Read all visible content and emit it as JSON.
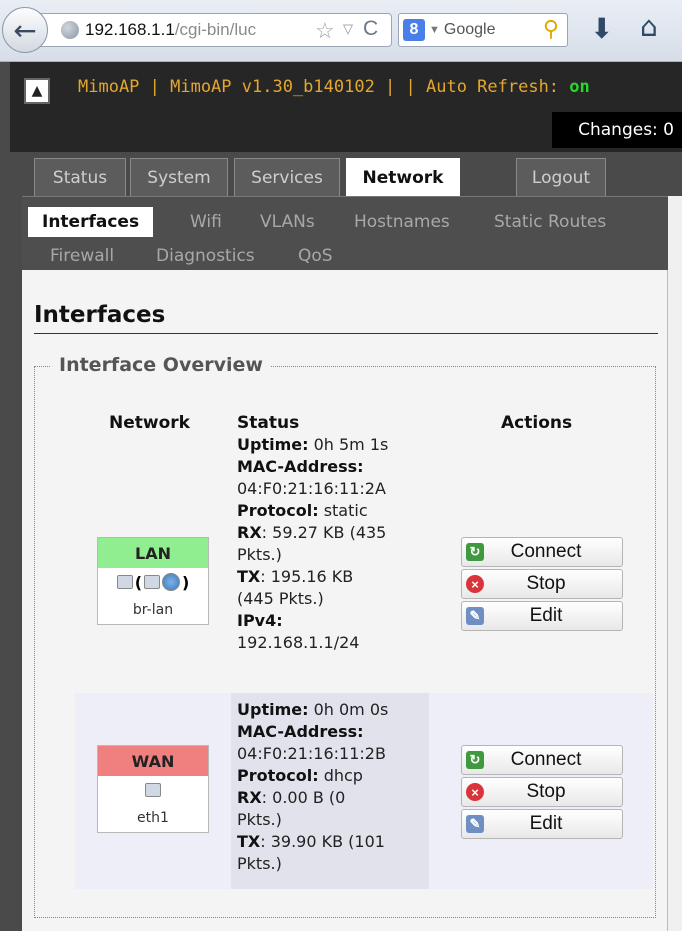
{
  "browser": {
    "url_host": "192.168.1.1",
    "url_path": "/cgi-bin/luc",
    "search_engine_letter": "8",
    "search_placeholder": "Google"
  },
  "header": {
    "title": "MimoAP | MimoAP v1.30_b140102 | | Auto Refresh: ",
    "autorefresh_value": "on",
    "changes": "Changes: 0"
  },
  "main_tabs": [
    {
      "label": "Status"
    },
    {
      "label": "System"
    },
    {
      "label": "Services"
    },
    {
      "label": "Network"
    },
    {
      "label": "Logout"
    }
  ],
  "sub_tabs": [
    {
      "label": "Interfaces"
    },
    {
      "label": "Wifi"
    },
    {
      "label": "VLANs"
    },
    {
      "label": "Hostnames"
    },
    {
      "label": "Static Routes"
    },
    {
      "label": "Firewall"
    },
    {
      "label": "Diagnostics"
    },
    {
      "label": "QoS"
    }
  ],
  "page": {
    "title": "Interfaces",
    "section": "Interface Overview",
    "col_network": "Network",
    "col_status": "Status",
    "col_actions": "Actions"
  },
  "interfaces": [
    {
      "name": "LAN",
      "device": "br-lan",
      "color": "#90ee90",
      "uptime_label": "Uptime:",
      "uptime": " 0h 5m 1s",
      "mac_label": "MAC-Address:",
      "mac_line1": "04:F0:21:16:11:2A",
      "proto_label": "Protocol:",
      "proto": " static",
      "rx_label": "RX",
      "rx": ": 59.27 KB (435",
      "rx2": "Pkts.)",
      "tx_label": "TX",
      "tx": ": 195.16 KB",
      "tx2": "(445 Pkts.)",
      "ipv4_label": "IPv4:",
      "ipv4": "192.168.1.1/24"
    },
    {
      "name": "WAN",
      "device": "eth1",
      "color": "#f08080",
      "uptime_label": "Uptime:",
      "uptime": " 0h 0m 0s",
      "mac_label": "MAC-Address:",
      "mac_line1": "04:F0:21:16:11:2B",
      "proto_label": "Protocol:",
      "proto": " dhcp",
      "rx_label": "RX",
      "rx": ": 0.00 B (0",
      "rx2": "Pkts.)",
      "tx_label": "TX",
      "tx": ": 39.90 KB (101",
      "tx2": "Pkts.)"
    }
  ],
  "actions": {
    "connect": "Connect",
    "stop": "Stop",
    "edit": "Edit"
  }
}
